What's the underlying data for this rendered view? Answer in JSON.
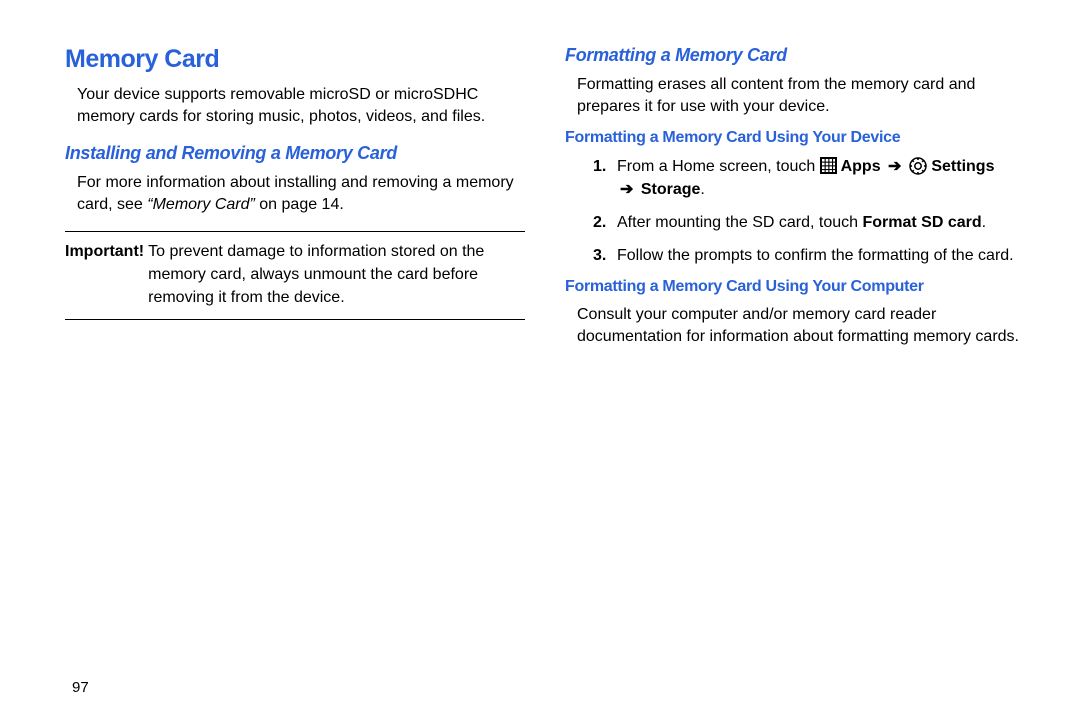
{
  "pageNumber": "97",
  "left": {
    "h1": "Memory Card",
    "intro": "Your device supports removable microSD or microSDHC memory cards for storing music, photos, videos, and files.",
    "h2": "Installing and Removing a Memory Card",
    "installText1": "For more information about installing and removing a memory card, see ",
    "xref": "“Memory Card”",
    "installText2": " on page 14.",
    "importantLabel": "Important!",
    "importantText": " To prevent damage to information stored on the memory card, always unmount the card before removing it from the device."
  },
  "right": {
    "h2": "Formatting a Memory Card",
    "intro": "Formatting erases all content from the memory card and prepares it for use with your device.",
    "h3a": "Formatting a Memory Card Using Your Device",
    "step1_a": "From a Home screen, touch ",
    "step1_apps": " Apps ",
    "step1_settings": " Settings ",
    "step1_storage": " Storage",
    "step2_a": "After mounting the SD card, touch ",
    "step2_b": "Format SD card",
    "step3": "Follow the prompts to confirm the formatting of the card.",
    "h3b": "Formatting a Memory Card Using Your Computer",
    "computerText": "Consult your computer and/or memory card reader documentation for information about formatting memory cards."
  }
}
